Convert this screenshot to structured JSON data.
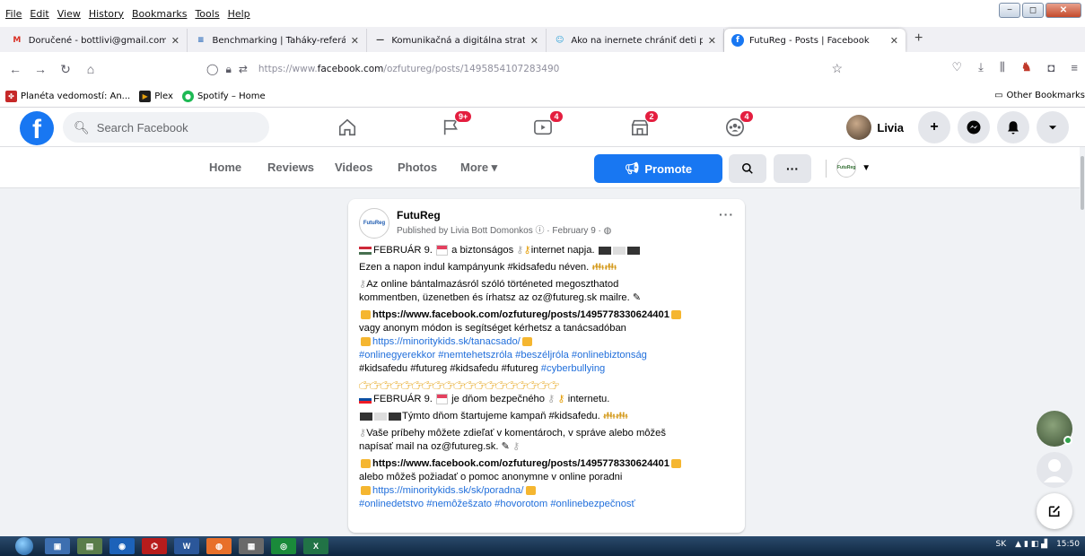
{
  "menubar": {
    "items": [
      "File",
      "Edit",
      "View",
      "History",
      "Bookmarks",
      "Tools",
      "Help"
    ]
  },
  "window_controls": {
    "minimize": "−",
    "restore": "◻",
    "close": "✕"
  },
  "tabs": [
    {
      "label": "Doručené - bottlivi@gmail.com",
      "icon": "gmail-icon",
      "icon_text": "M",
      "color": "#d93025"
    },
    {
      "label": "Benchmarking | Ťaháky-referát",
      "icon": "doc-icon",
      "icon_text": "≡",
      "color": "#1a5fb4"
    },
    {
      "label": "Komunikačná a digitálna straté",
      "icon": "dash-icon",
      "icon_text": "—",
      "color": "#333333"
    },
    {
      "label": "Ako na inernete chrániť deti pr",
      "icon": "people-icon",
      "icon_text": "☺",
      "color": "#2aa0d8"
    },
    {
      "label": "FutuReg - Posts | Facebook",
      "icon": "facebook-icon",
      "icon_text": "f",
      "color": "#1877f2",
      "active": true
    }
  ],
  "newtab_label": "+",
  "url": {
    "scheme": "https://www.",
    "host": "facebook.com",
    "path": "/ozfutureg/posts/1495854107283490"
  },
  "bookmarks": [
    {
      "label": "Planéta vedomostí: An...",
      "icon": "planet-icon",
      "icon_text": "✤",
      "color": "#c62828"
    },
    {
      "label": "Plex",
      "icon": "plex-icon",
      "icon_text": "▶",
      "color": "#e5a00d"
    },
    {
      "label": "Spotify – Home",
      "icon": "spotify-icon",
      "icon_text": "●",
      "color": "#1db954"
    }
  ],
  "other_bookmarks": "Other Bookmarks",
  "facebook": {
    "search_placeholder": "Search Facebook",
    "badges": {
      "pages": "9+",
      "watch": "4",
      "marketplace": "2",
      "groups": "4"
    },
    "profile_name": "Livia",
    "page_nav": {
      "home": "Home",
      "reviews": "Reviews",
      "videos": "Videos",
      "photos": "Photos",
      "more": "More ▾",
      "promote": "Promote",
      "search": "Q",
      "dots": "···"
    }
  },
  "post": {
    "page_name": "FutuReg",
    "logo_text": "FutuReg",
    "meta": "Published by Livia Bott Domonkos",
    "date": "February 9",
    "dots": "···",
    "hu_line1_a": "FEBRUÁR 9.",
    "hu_line1_b": "a biztonságos",
    "hu_line1_c": "internet napja.",
    "hu_line2": "Ezen a napon indul kampányunk #kidsafedu néven.",
    "hu_line3a": "Az online bántalmazásról szóló történeted megoszthatod",
    "hu_line3b": "kommentben, üzenetben és írhatsz az oz@futureg.sk mailre.",
    "link1": "https://www.facebook.com/ozfutureg/posts/1495778330624401",
    "hu_line4": "vagy anonym módon is segítséget kérhetsz a tanácsadóban",
    "link2": "https://minoritykids.sk/tanacsado/",
    "tags1": "#onlinegyerekkor #nemtehetszróla  #beszéljróla #onlinebiztonság",
    "tags2_plain": "#kidsafedu  #futureg #kidsafedu  #futureg",
    "tags2_link": "#cyberbullying",
    "hands": "👉👉👉👉👉👉👉👉👉👉👉👉👉👉👉👉👉👉👉",
    "sk_line1_a": "FEBRUÁR 9.",
    "sk_line1_b": "je dňom bezpečného",
    "sk_line1_c": "internetu.",
    "sk_line2": "Týmto dňom štartujeme kampaň #kidsafedu.",
    "sk_line3a": "Vaše príbehy môžete zdieľať v komentároch, v správe alebo môžeš",
    "sk_line3b": "napísať mail na oz@futureg.sk.",
    "link3": "https://www.facebook.com/ozfutureg/posts/1495778330624401",
    "sk_line4": "alebo môžeš požiadať o pomoc anonymne v online poradni",
    "link4": "https://minoritykids.sk/sk/poradna/",
    "tags3": "#onlinedetstvo #nemôžešzato  #hovorotom #onlinebezpečnosť"
  },
  "taskbar": {
    "tray_lang": "SK",
    "time": "15:50"
  },
  "colors": {
    "facebook_blue": "#1877f2",
    "badge_red": "#e41e3f",
    "link": "#216fdb"
  }
}
